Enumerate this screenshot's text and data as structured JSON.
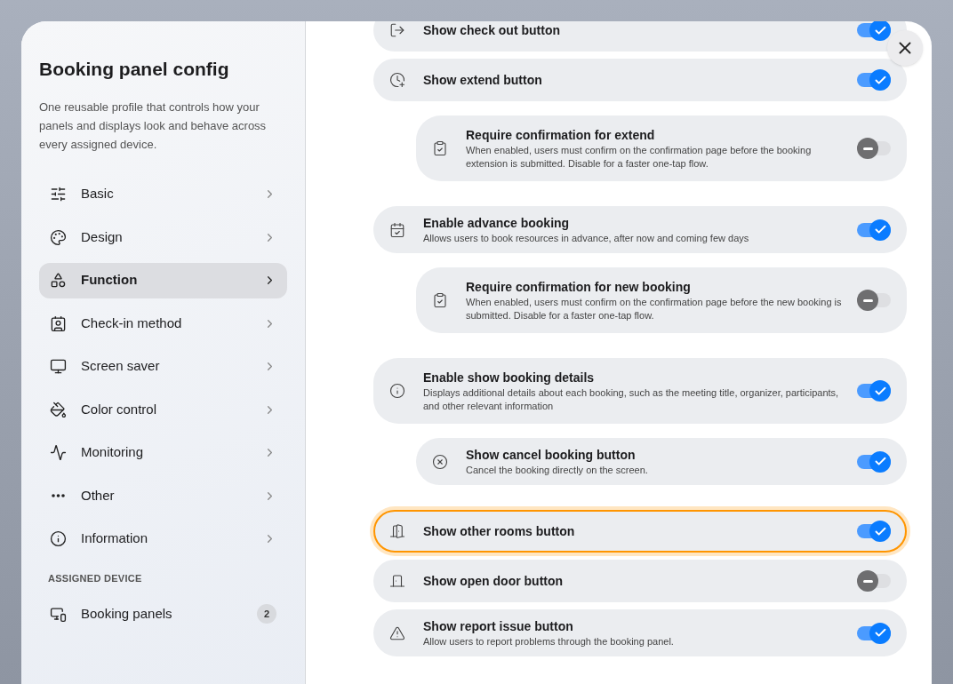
{
  "sidebar": {
    "title": "Booking panel config",
    "description": "One reusable profile that controls how your panels and displays look and behave across every assigned device.",
    "items": [
      {
        "label": "Basic",
        "selected": false
      },
      {
        "label": "Design",
        "selected": false
      },
      {
        "label": "Function",
        "selected": true
      },
      {
        "label": "Check-in method",
        "selected": false
      },
      {
        "label": "Screen saver",
        "selected": false
      },
      {
        "label": "Color control",
        "selected": false
      },
      {
        "label": "Monitoring",
        "selected": false
      },
      {
        "label": "Other",
        "selected": false
      },
      {
        "label": "Information",
        "selected": false
      }
    ],
    "section_label": "ASSIGNED DEVICE",
    "devices": [
      {
        "label": "Booking panels",
        "count": "2",
        "selected": false
      }
    ]
  },
  "settings": [
    {
      "title": "Show check out button",
      "on": true,
      "highlighted": false
    },
    {
      "title": "Show extend button",
      "on": true,
      "highlighted": false,
      "children": [
        {
          "title": "Require confirmation for extend",
          "description": "When enabled, users must confirm on the confirmation page before the booking extension is submitted. Disable for a faster one-tap flow.",
          "on": false,
          "highlighted": false
        }
      ]
    },
    {
      "title": "Enable advance booking",
      "description": "Allows users to book resources in advance, after now and coming few days",
      "on": true,
      "highlighted": false,
      "children": [
        {
          "title": "Require confirmation for new booking",
          "description": "When enabled, users must confirm on the confirmation page before the new booking is submitted. Disable for a faster one-tap flow.",
          "on": false,
          "highlighted": false
        }
      ]
    },
    {
      "title": "Enable show booking details",
      "description": "Displays additional details about each booking, such as the meeting title, organizer, participants, and other relevant information",
      "on": true,
      "highlighted": false,
      "children": [
        {
          "title": "Show cancel booking button",
          "description": "Cancel the booking directly on the screen.",
          "on": true,
          "highlighted": false
        }
      ]
    },
    {
      "title": "Show other rooms button",
      "on": true,
      "highlighted": true
    },
    {
      "title": "Show open door button",
      "on": false,
      "highlighted": false
    },
    {
      "title": "Show report issue button",
      "description": "Allow users to report problems through the booking panel.",
      "on": true,
      "highlighted": false
    }
  ]
}
